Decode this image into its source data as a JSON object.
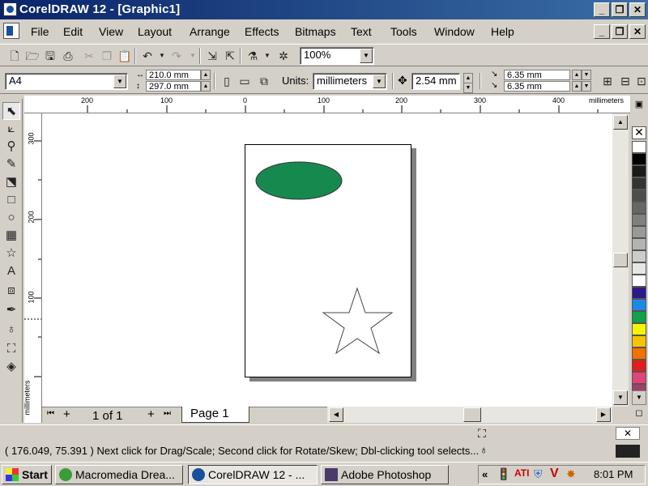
{
  "window": {
    "title": "CorelDRAW 12 - [Graphic1]",
    "min": "_",
    "max": "❐",
    "close": "✕"
  },
  "menu": {
    "items": [
      "File",
      "Edit",
      "View",
      "Layout",
      "Arrange",
      "Effects",
      "Bitmaps",
      "Text",
      "Tools",
      "Window",
      "Help"
    ]
  },
  "toolbar": {
    "zoom": "100%"
  },
  "property_bar": {
    "page_size": "A4",
    "width": "210.0 mm",
    "height": "297.0 mm",
    "units_label": "Units:",
    "units_value": "millimeters",
    "nudge": "2.54 mm",
    "dup_x": "6.35 mm",
    "dup_y": "6.35 mm"
  },
  "ruler": {
    "h_labels": [
      "200",
      "100",
      "0",
      "100",
      "200",
      "300",
      "400"
    ],
    "h_unit": "millimeters",
    "v_labels": [
      "300",
      "200",
      "100"
    ],
    "v_unit": "millimeters"
  },
  "page_nav": {
    "counter": "1 of 1",
    "tab": "Page 1"
  },
  "status": {
    "text": "( 176.049, 75.391 ) Next click for Drag/Scale; Second click for Rotate/Skew; Dbl-clicking tool selects..."
  },
  "shapes": {
    "ellipse_fill": "#168a4e",
    "star_stroke": "#444444"
  },
  "palette": [
    "#ffffff",
    "#000000",
    "#1a1a1a",
    "#333333",
    "#4d4d4d",
    "#666666",
    "#808080",
    "#999999",
    "#b3b3b3",
    "#cccccc",
    "#e6e6e6",
    "#ffffff",
    "#2e1a87",
    "#1e88e5",
    "#12a04a",
    "#f5f500",
    "#f5c400",
    "#f07000",
    "#e31c1c",
    "#e0457a",
    "#a0406a"
  ],
  "taskbar": {
    "start": "Start",
    "tasks": [
      "Macromedia Drea...",
      "CorelDRAW 12 - ...",
      "Adobe Photoshop"
    ],
    "time": "8:01 PM"
  }
}
